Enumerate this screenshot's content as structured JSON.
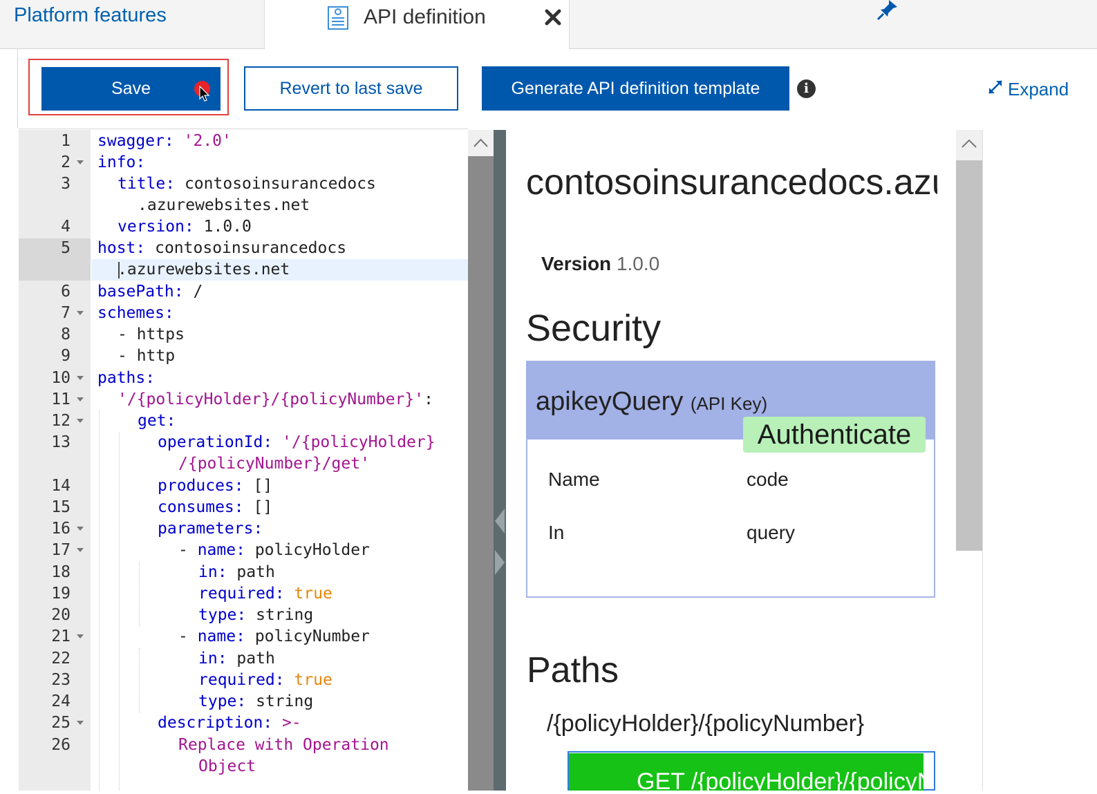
{
  "tabs": {
    "platform_label": "Platform features",
    "api_label": "API definition"
  },
  "toolbar": {
    "save_label": "Save",
    "revert_label": "Revert to last save",
    "generate_label": "Generate API definition template",
    "expand_label": "Expand"
  },
  "editor": {
    "line_numbers": [
      "1",
      "2",
      "3",
      "4",
      "5",
      "6",
      "7",
      "8",
      "9",
      "10",
      "11",
      "12",
      "13",
      "14",
      "15",
      "16",
      "17",
      "18",
      "19",
      "20",
      "21",
      "22",
      "23",
      "24",
      "25",
      "26"
    ],
    "lines": {
      "l1k": "swagger:",
      "l1v": "'2.0'",
      "l2k": "info:",
      "l3k": "title:",
      "l3v": "contosoinsurancedocs",
      "l3c": ".azurewebsites.net",
      "l4k": "version:",
      "l4v": "1.0.0",
      "l5k": "host:",
      "l5v": "contosoinsurancedocs",
      "l5c": ".azurewebsites.net",
      "l6k": "basePath:",
      "l6v": "/",
      "l7k": "schemes:",
      "l8v": "- https",
      "l9v": "- http",
      "l10k": "paths:",
      "l11s": "'/{policyHolder}/{policyNumber}'",
      "l11p": ":",
      "l12k": "get:",
      "l13k": "operationId:",
      "l13v": "'/{policyHolder}",
      "l13c": "/{policyNumber}/get'",
      "l14k": "produces:",
      "l14v": "[]",
      "l15k": "consumes:",
      "l15v": "[]",
      "l16k": "parameters:",
      "l17d": "- ",
      "l17k": "name:",
      "l17v": "policyHolder",
      "l18k": "in:",
      "l18v": "path",
      "l19k": "required:",
      "l19v": "true",
      "l20k": "type:",
      "l20v": "string",
      "l21d": "- ",
      "l21k": "name:",
      "l21v": "policyNumber",
      "l22k": "in:",
      "l22v": "path",
      "l23k": "required:",
      "l23v": "true",
      "l24k": "type:",
      "l24v": "string",
      "l25k": "description:",
      "l25v": ">-",
      "l26v": "Replace with Operation",
      "l26c": "Object"
    }
  },
  "preview": {
    "title": "contosoinsurancedocs.azurewebsites.net",
    "version_label": "Version",
    "version_value": "1.0.0",
    "security_heading": "Security",
    "security_scheme": "apikeyQuery",
    "security_type": "(API Key)",
    "authenticate_label": "Authenticate",
    "name_label": "Name",
    "name_value": "code",
    "in_label": "In",
    "in_value": "query",
    "paths_heading": "Paths",
    "path_route": "/{policyHolder}/{policyNumber}",
    "operation_label": "GET /{policyHolder}/{policyNumber}"
  },
  "colors": {
    "accent": "#0058ad",
    "highlight_border": "#e0413c",
    "security_header": "#a2b1e6",
    "authenticate_bg": "#b8f0b8",
    "get_operation": "#15c215"
  }
}
